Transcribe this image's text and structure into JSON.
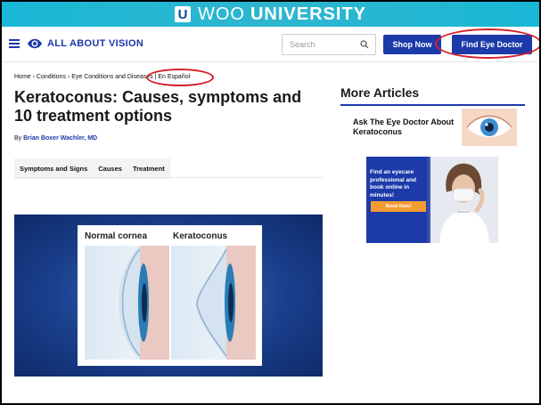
{
  "banner": {
    "logo_letter": "U",
    "word1": "WOO",
    "word2": "UNIVERSITY"
  },
  "nav": {
    "brand": "ALL ABOUT VISION",
    "search_placeholder": "Search",
    "shop_now": "Shop Now",
    "find_doctor": "Find Eye Doctor"
  },
  "breadcrumb": {
    "text": "Home › Conditions › Eye Conditions and Diseases | En Español"
  },
  "article": {
    "title": "Keratoconus: Causes, symptoms and 10 treatment options",
    "byline_prefix": "By",
    "author": "Brian Boxer Wachler, MD",
    "tabs": [
      "Symptoms and Signs",
      "Causes",
      "Treatment"
    ],
    "hero": {
      "label_left": "Normal cornea",
      "label_right": "Keratoconus"
    }
  },
  "sidebar": {
    "heading": "More Articles",
    "article_title": "Ask The Eye Doctor About Keratoconus",
    "ad": {
      "text": "Find an eyecare professional and book online in minutes!",
      "button": "Book Now!"
    }
  },
  "colors": {
    "brand_blue": "#1c3aa9",
    "banner": "#19b8d6",
    "highlight": "#d3202a",
    "ad_button": "#f39c30"
  },
  "icons": [
    "hamburger-icon",
    "aav-eye-logo-icon",
    "search-icon"
  ]
}
